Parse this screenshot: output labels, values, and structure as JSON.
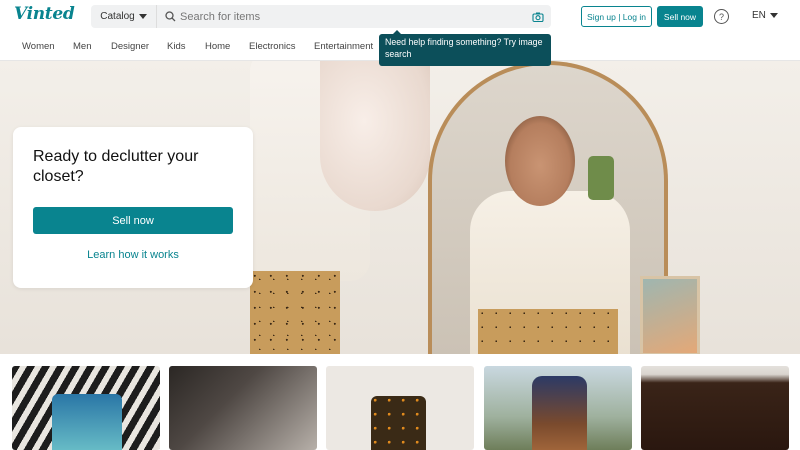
{
  "header": {
    "logo": "Vinted",
    "catalog_label": "Catalog",
    "search_placeholder": "Search for items",
    "signup_login_label": "Sign up | Log in",
    "sell_now_label": "Sell now",
    "help_glyph": "?",
    "language": "EN"
  },
  "categories": [
    "Women",
    "Men",
    "Designer",
    "Kids",
    "Home",
    "Electronics",
    "Entertainment"
  ],
  "tooltip": "Need help finding something? Try image search",
  "hero": {
    "title": "Ready to declutter your closet?",
    "sell_button": "Sell now",
    "learn_link": "Learn how it works"
  },
  "icons": {
    "search": "search-icon",
    "camera": "camera-icon",
    "help": "help-icon",
    "caret": "chevron-down-icon"
  },
  "colors": {
    "brand": "#09848f",
    "tooltip_bg": "#0c4f5a"
  }
}
